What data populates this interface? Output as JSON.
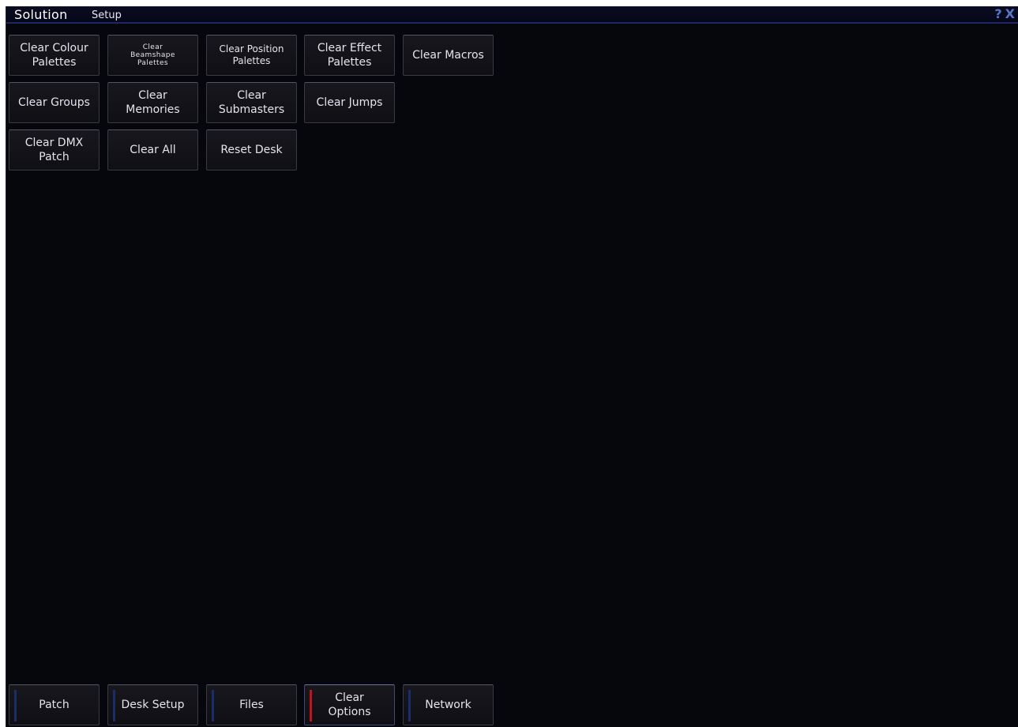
{
  "app": {
    "brand": "Solution",
    "window_title": "Setup",
    "help_label": "?",
    "close_label": "X"
  },
  "clear_buttons": {
    "colour": "Clear Colour\nPalettes",
    "beamshape": "Clear\nBeamshape\nPalettes",
    "position": "Clear Position\nPalettes",
    "effect": "Clear Effect\nPalettes",
    "macros": "Clear Macros",
    "groups": "Clear Groups",
    "memories": "Clear\nMemories",
    "submasters": "Clear\nSubmasters",
    "jumps": "Clear Jumps",
    "dmx_patch": "Clear DMX\nPatch",
    "all": "Clear All",
    "reset_desk": "Reset Desk"
  },
  "tabs": {
    "patch": "Patch",
    "desk_setup": "Desk Setup",
    "files": "Files",
    "clear_options": "Clear\nOptions",
    "network": "Network",
    "active": "clear_options"
  },
  "colors": {
    "background": "#06060d",
    "active_tab_indicator": "#c0141c",
    "inactive_tab_indicator": "#1a2f6a",
    "title_icons": "#5676c8"
  }
}
